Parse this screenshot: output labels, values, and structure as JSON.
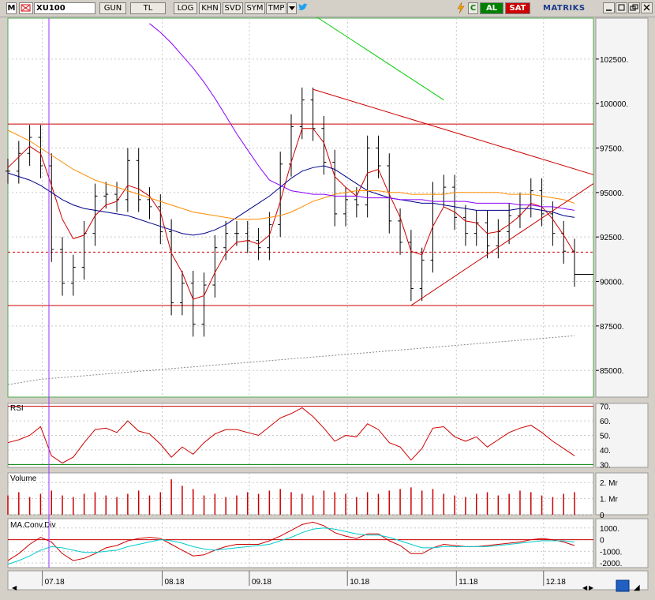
{
  "toolbar": {
    "m_label": "M",
    "symbol": "XU100",
    "period_label": "GUN",
    "currency_label": "TL",
    "log_label": "LOG",
    "khn_label": "KHN",
    "svd_label": "SVD",
    "sym_label": "SYM",
    "tmp_label": "TMP",
    "refresh_label": "C",
    "buy_label": "AL",
    "sell_label": "SAT",
    "brand": "MATRIKS",
    "accent_buy": "#008000",
    "accent_sell": "#cc0000"
  },
  "chart_data": [
    {
      "type": "line",
      "title": "",
      "price_axis_ticks": [
        "102500.",
        "100000.",
        "97500.",
        "95000.",
        "92500.",
        "90000.",
        "87500.",
        "85000."
      ],
      "price_axis_values": [
        102500,
        100000,
        97500,
        95000,
        92500,
        90000,
        87500,
        85000
      ],
      "ylim": [
        83500,
        104800
      ],
      "x_tick_labels": [
        "07.18",
        "08.18",
        "09.18",
        "10.18",
        "11.18",
        "12.18"
      ],
      "horizontal_lines": [
        {
          "value": 98850,
          "style": "solid",
          "color": "#cc0000"
        },
        {
          "value": 91650,
          "style": "dashed",
          "color": "#cc0000"
        },
        {
          "value": 88650,
          "style": "solid",
          "color": "#cc0000"
        }
      ],
      "close_series": [
        96200,
        97200,
        98100,
        96500,
        91800,
        89900,
        90800,
        92700,
        94800,
        94900,
        94600,
        96800,
        94600,
        94200,
        92800,
        88800,
        89900,
        87600,
        89800,
        91900,
        92700,
        92700,
        92300,
        91900,
        93200,
        96600,
        98700,
        100200,
        98600,
        96700,
        93800,
        94600,
        94300,
        97500,
        96500,
        93400,
        92200,
        89600,
        91200,
        94900,
        95300,
        93600,
        92700,
        93300,
        92000,
        92800,
        93700,
        94300,
        95100,
        93800,
        92700,
        91700,
        90400
      ],
      "series": [
        {
          "values": [
            96400,
            97000,
            97600,
            97200,
            95400,
            93500,
            92400,
            92600,
            93700,
            94300,
            94500,
            95400,
            95200,
            94800,
            93900,
            91600,
            90500,
            89000,
            89200,
            90500,
            91600,
            92200,
            92300,
            92100,
            92600,
            94500,
            96700,
            98600,
            98600,
            97800,
            95900,
            95300,
            94800,
            96100,
            96300,
            94900,
            93600,
            91700,
            91500,
            93100,
            94200,
            93900,
            93400,
            93300,
            92700,
            92800,
            93200,
            93700,
            94400,
            94200,
            93500,
            92600,
            91600
          ],
          "color": "#cc0000"
        },
        {
          "values": [
            96100,
            95900,
            95700,
            95400,
            95000,
            94600,
            94300,
            94100,
            94000,
            93900,
            93800,
            93700,
            93500,
            93300,
            93100,
            92900,
            92700,
            92600,
            92700,
            92900,
            93200,
            93600,
            94000,
            94400,
            94800,
            95300,
            95800,
            96200,
            96400,
            96500,
            96300,
            95900,
            95500,
            95100,
            94900,
            94700,
            94600,
            94500,
            94400,
            94400,
            94300,
            94200,
            94100,
            94000,
            94000,
            94000,
            94000,
            94100,
            94100,
            94000,
            93900,
            93700,
            93600
          ],
          "color": "#00008b"
        },
        {
          "values": [
            98500,
            98200,
            97900,
            97500,
            97100,
            96700,
            96300,
            96000,
            95700,
            95500,
            95300,
            95100,
            94900,
            94700,
            94500,
            94300,
            94100,
            93900,
            93800,
            93700,
            93600,
            93500,
            93500,
            93500,
            93600,
            93700,
            93900,
            94200,
            94500,
            94700,
            94900,
            95000,
            95100,
            95100,
            95100,
            95000,
            95000,
            94900,
            94900,
            94900,
            94900,
            95000,
            95000,
            95000,
            95000,
            95000,
            94900,
            94900,
            94900,
            94800,
            94700,
            94600,
            94400
          ],
          "color": "#ff8c00"
        },
        {
          "values": [
            null,
            null,
            null,
            null,
            null,
            null,
            null,
            null,
            null,
            null,
            null,
            null,
            null,
            104500,
            104000,
            103400,
            102700,
            102000,
            101200,
            100300,
            99300,
            98300,
            97400,
            96500,
            95700,
            95400,
            95100,
            95000,
            94900,
            94900,
            94800,
            94800,
            94800,
            94700,
            94700,
            94700,
            94600,
            94600,
            94600,
            94500,
            94500,
            94500,
            94500,
            94400,
            94400,
            94400,
            94400,
            94300,
            94300,
            94200,
            94200,
            94100,
            94000
          ],
          "color": "#8b00ff"
        },
        {
          "values": [
            null,
            null,
            null,
            null,
            null,
            null,
            null,
            null,
            null,
            null,
            null,
            null,
            null,
            null,
            null,
            null,
            null,
            null,
            null,
            null,
            null,
            null,
            null,
            null,
            null,
            null,
            null,
            null,
            105000,
            104600,
            104200,
            103800,
            103400,
            103000,
            102600,
            102200,
            101800,
            101400,
            101000,
            100600,
            100200
          ],
          "color": "#00cc00"
        },
        {
          "values": [
            84200,
            84300,
            84400,
            84500,
            84550,
            84600,
            84650,
            84700,
            84750,
            84800,
            84850,
            84900,
            84950,
            85000,
            85050,
            85100,
            85150,
            85200,
            85250,
            85300,
            85350,
            85400,
            85450,
            85500,
            85550,
            85600,
            85650,
            85700,
            85750,
            85800,
            85850,
            85900,
            85950,
            86000,
            86050,
            86100,
            86150,
            86200,
            86250,
            86300,
            86350,
            86400,
            86450,
            86500,
            86550,
            86600,
            86650,
            86700,
            86750,
            86800,
            86850,
            86900,
            86950
          ],
          "color": "#888888"
        }
      ]
    },
    {
      "type": "line",
      "title": "RSI",
      "axis_ticks": [
        "70.",
        "60.",
        "50.",
        "40.",
        "30."
      ],
      "axis_values": [
        70,
        60,
        50,
        40,
        30
      ],
      "ylim": [
        28,
        72
      ],
      "reference_lines": [
        {
          "value": 70,
          "color": "#cc0000"
        },
        {
          "value": 30,
          "color": "#008000"
        }
      ],
      "series": [
        {
          "values": [
            45,
            47,
            50,
            56,
            36,
            31,
            35,
            45,
            54,
            55,
            52,
            60,
            53,
            51,
            44,
            35,
            42,
            37,
            45,
            51,
            54,
            54,
            52,
            50,
            56,
            62,
            65,
            69,
            63,
            55,
            46,
            50,
            49,
            58,
            54,
            45,
            42,
            33,
            41,
            55,
            56,
            49,
            46,
            49,
            42,
            47,
            52,
            55,
            57,
            52,
            46,
            41,
            36
          ],
          "color": "#cc0000"
        }
      ]
    },
    {
      "type": "bar",
      "title": "Volume",
      "axis_ticks": [
        "2. Mr",
        "1. Mr",
        "0"
      ],
      "axis_values": [
        2,
        1,
        0
      ],
      "unit": "Mr",
      "ylim": [
        0,
        2.6
      ],
      "series": [
        {
          "values": [
            1.2,
            1.4,
            1.1,
            1.3,
            1.5,
            1.2,
            1.1,
            1.3,
            1.4,
            1.2,
            1.1,
            1.3,
            1.5,
            1.2,
            1.4,
            2.2,
            1.8,
            1.6,
            1.2,
            1.3,
            1.1,
            1.2,
            1.4,
            1.3,
            1.5,
            1.6,
            1.4,
            1.3,
            1.2,
            1.5,
            1.4,
            1.3,
            1.1,
            1.4,
            1.3,
            1.5,
            1.6,
            1.7,
            1.5,
            1.6,
            1.3,
            1.2,
            1.1,
            1.3,
            1.4,
            1.2,
            1.3,
            1.5,
            1.4,
            1.2,
            1.1,
            1.3,
            1.4
          ],
          "color": "#cc0000"
        }
      ]
    },
    {
      "type": "line",
      "title": "MA.Conv.Div",
      "axis_ticks": [
        "1000.",
        "0",
        "-1000.",
        "-2000."
      ],
      "axis_values": [
        1000,
        0,
        -1000,
        -2000
      ],
      "ylim": [
        -2400,
        1800
      ],
      "reference_lines": [
        {
          "value": 0,
          "color": "#cc0000"
        }
      ],
      "series": [
        {
          "values": [
            -1800,
            -1200,
            -400,
            200,
            -200,
            -1200,
            -1800,
            -1600,
            -1200,
            -700,
            -500,
            -100,
            100,
            200,
            100,
            -400,
            -900,
            -1400,
            -1300,
            -900,
            -600,
            -400,
            -400,
            -400,
            -100,
            300,
            800,
            1300,
            1500,
            1200,
            600,
            300,
            100,
            500,
            500,
            -100,
            -500,
            -1200,
            -1200,
            -700,
            -400,
            -500,
            -600,
            -600,
            -500,
            -400,
            -300,
            -200,
            0,
            100,
            0,
            -200,
            -500
          ],
          "color": "#cc0000"
        },
        {
          "values": [
            -2100,
            -1800,
            -1400,
            -900,
            -600,
            -700,
            -900,
            -1100,
            -1100,
            -1000,
            -900,
            -600,
            -400,
            -200,
            0,
            -100,
            -300,
            -600,
            -800,
            -900,
            -800,
            -700,
            -600,
            -500,
            -400,
            -100,
            200,
            600,
            900,
            1000,
            900,
            700,
            500,
            400,
            400,
            200,
            -100,
            -400,
            -700,
            -700,
            -600,
            -600,
            -600,
            -600,
            -600,
            -500,
            -400,
            -300,
            -200,
            -100,
            -100,
            -100,
            -200
          ],
          "color": "#00cccc"
        }
      ]
    }
  ],
  "colors": {
    "plot_background": "#ffffff",
    "frame": "#4fa84f",
    "cursor_line": "#9b30ff",
    "grid": "#c8c8c8"
  }
}
